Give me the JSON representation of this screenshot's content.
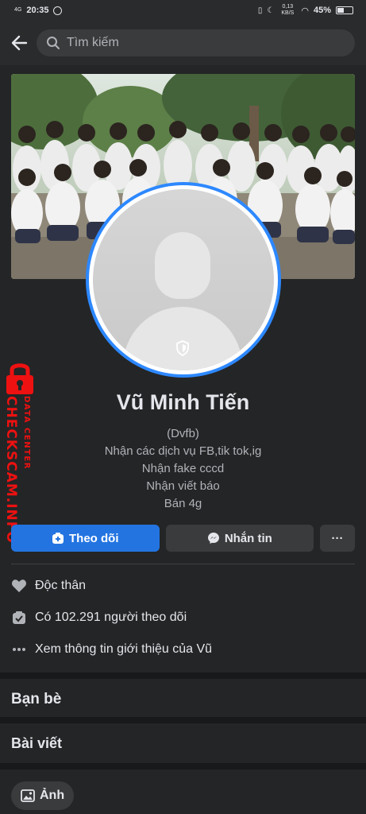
{
  "status_bar": {
    "network": "4G",
    "time": "20:35",
    "speed": "0,13 KB/S",
    "battery": "45%",
    "battery_level": 0.45
  },
  "search": {
    "placeholder": "Tìm kiếm"
  },
  "profile": {
    "name": "Vũ Minh Tiến",
    "bio": [
      "(Dvfb)",
      "Nhận các dịch vụ FB,tik tok,ig",
      "Nhận fake cccd",
      "Nhận viết báo",
      "Bán 4g"
    ]
  },
  "actions": {
    "follow_label": "Theo dõi",
    "message_label": "Nhắn tin",
    "more_label": "···"
  },
  "details": {
    "relationship": "Độc thân",
    "followers": "Có 102.291 người theo dõi",
    "about_link": "Xem thông tin giới thiệu của Vũ"
  },
  "sections": {
    "friends": "Bạn bè",
    "posts": "Bài viết",
    "photos": "Ảnh"
  },
  "watermark": {
    "site": "CHECKSCAM.INFO",
    "caption": "DATA CENTER"
  },
  "colors": {
    "accent": "#2374e1",
    "ring": "#2d88ff",
    "background": "#242526",
    "watermark": "#ee1111"
  }
}
